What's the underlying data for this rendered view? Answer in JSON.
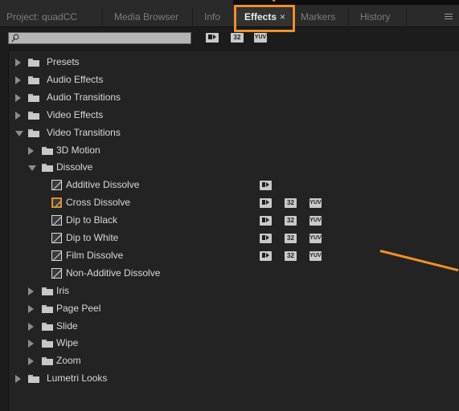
{
  "tabs": [
    {
      "label": "Project: quadCC",
      "active": false
    },
    {
      "label": "Media Browser",
      "active": false
    },
    {
      "label": "Info",
      "active": false
    },
    {
      "label": "Effects",
      "active": true
    },
    {
      "label": "Markers",
      "active": false
    },
    {
      "label": "History",
      "active": false
    }
  ],
  "close_glyph": "×",
  "search": {
    "placeholder": "",
    "value": ""
  },
  "toolbar_badges": [
    "32",
    "YUV"
  ],
  "tree": [
    {
      "label": "Presets",
      "depth": 0,
      "type": "folder",
      "expanded": false
    },
    {
      "label": "Audio Effects",
      "depth": 0,
      "type": "folder",
      "expanded": false
    },
    {
      "label": "Audio Transitions",
      "depth": 0,
      "type": "folder",
      "expanded": false
    },
    {
      "label": "Video Effects",
      "depth": 0,
      "type": "folder",
      "expanded": false
    },
    {
      "label": "Video Transitions",
      "depth": 0,
      "type": "folder",
      "expanded": true
    },
    {
      "label": "3D Motion",
      "depth": 1,
      "type": "folder",
      "expanded": false
    },
    {
      "label": "Dissolve",
      "depth": 1,
      "type": "folder",
      "expanded": true
    },
    {
      "label": "Additive Dissolve",
      "depth": 2,
      "type": "effect",
      "badges": [
        "accel"
      ]
    },
    {
      "label": "Cross Dissolve",
      "depth": 2,
      "type": "effect",
      "selected": true,
      "badges": [
        "accel",
        "32",
        "YUV"
      ]
    },
    {
      "label": "Dip to Black",
      "depth": 2,
      "type": "effect",
      "badges": [
        "accel",
        "32",
        "YUV"
      ]
    },
    {
      "label": "Dip to White",
      "depth": 2,
      "type": "effect",
      "badges": [
        "accel",
        "32",
        "YUV"
      ]
    },
    {
      "label": "Film Dissolve",
      "depth": 2,
      "type": "effect",
      "badges": [
        "accel",
        "32",
        "YUV"
      ]
    },
    {
      "label": "Non-Additive Dissolve",
      "depth": 2,
      "type": "effect",
      "badges": []
    },
    {
      "label": "Iris",
      "depth": 1,
      "type": "folder",
      "expanded": false
    },
    {
      "label": "Page Peel",
      "depth": 1,
      "type": "folder",
      "expanded": false
    },
    {
      "label": "Slide",
      "depth": 1,
      "type": "folder",
      "expanded": false
    },
    {
      "label": "Wipe",
      "depth": 1,
      "type": "folder",
      "expanded": false
    },
    {
      "label": "Zoom",
      "depth": 1,
      "type": "folder",
      "expanded": false
    },
    {
      "label": "Lumetri Looks",
      "depth": 0,
      "type": "folder",
      "expanded": false
    }
  ],
  "colors": {
    "highlight": "#f0902a",
    "background": "#232323",
    "tab_bar": "#2a2a2a"
  }
}
